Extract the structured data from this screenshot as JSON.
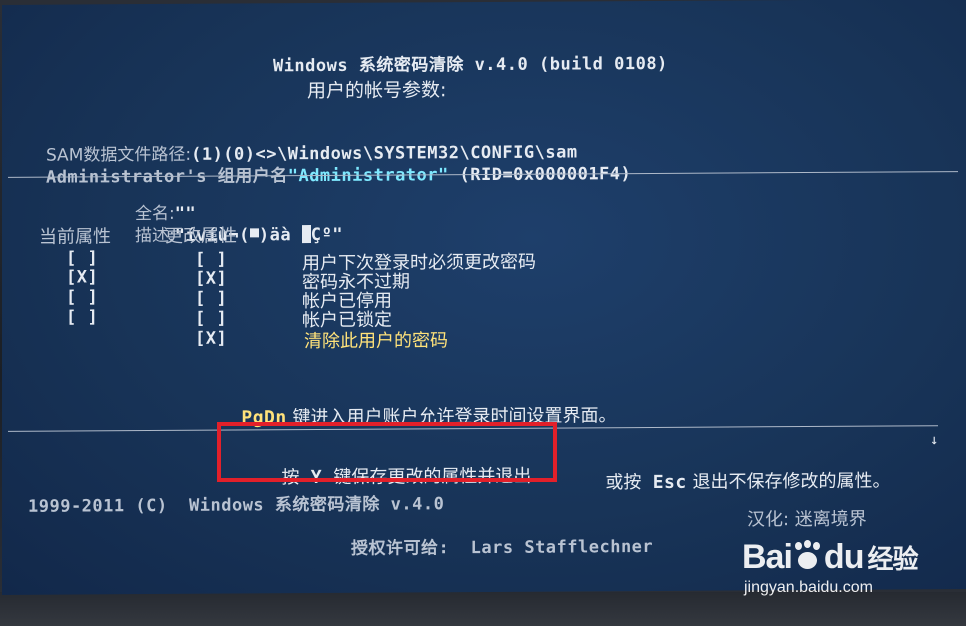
{
  "header": {
    "title": "Windows 系统密码清除 v.4.0 (build 0108)",
    "subtitle": "用户的帐号参数:"
  },
  "info": {
    "sam_path_label": "SAM数据文件路径:",
    "sam_path_value": "(1)(0)<>\\Windows\\SYSTEM32\\CONFIG\\sam",
    "user_line_prefix": "Administrator's 组用户名",
    "user_name": "\"Administrator\"",
    "rid": "(RID=0x000001F4)"
  },
  "fields": {
    "fullname_label": "全名:",
    "fullname_value": "\"\"",
    "desc_label": "描述:",
    "desc_value_a": "\"ívíù¬(",
    "desc_value_b": ")äà ",
    "desc_value_c": "Çº\""
  },
  "attributes": {
    "current_header": "当前属性",
    "change_header": "更改属性",
    "rows": [
      {
        "current": "[ ]",
        "change": "[ ]",
        "label": "用户下次登录时必须更改密码"
      },
      {
        "current": "[X]",
        "change": "[X]",
        "label": "密码永不过期"
      },
      {
        "current": "[ ]",
        "change": "[ ]",
        "label": "帐户已停用"
      },
      {
        "current": "[ ]",
        "change": "[ ]",
        "label": "帐户已锁定"
      },
      {
        "current": "",
        "change": "[X]",
        "label": "清除此用户的密码"
      }
    ]
  },
  "pgdn": {
    "key": "PgDn",
    "text": "键进入用户账户允许登录时间设置界面。"
  },
  "actions": {
    "press": "按",
    "save_key": "Y",
    "save_text": "键保存更改的属性并退出",
    "or_press": "或按",
    "esc_key": "Esc",
    "esc_text": "退出不保存修改的属性。",
    "scroll_arrow": "↓"
  },
  "footer": {
    "copyright": "1999-2011 (C)  Windows 系统密码清除 v.4.0",
    "license": "授权许可给:  Lars Stafflechner",
    "translation": "汉化: 迷离境界"
  },
  "watermark": {
    "brand": "Bai",
    "brand2": "du",
    "suffix": "经验",
    "url": "jingyan.baidu.com"
  },
  "colors": {
    "screen": "#183458",
    "highlight_cyan": "#7fe9ff",
    "highlight_yellow": "#ffe27a",
    "annotation_red": "#e2202a"
  }
}
